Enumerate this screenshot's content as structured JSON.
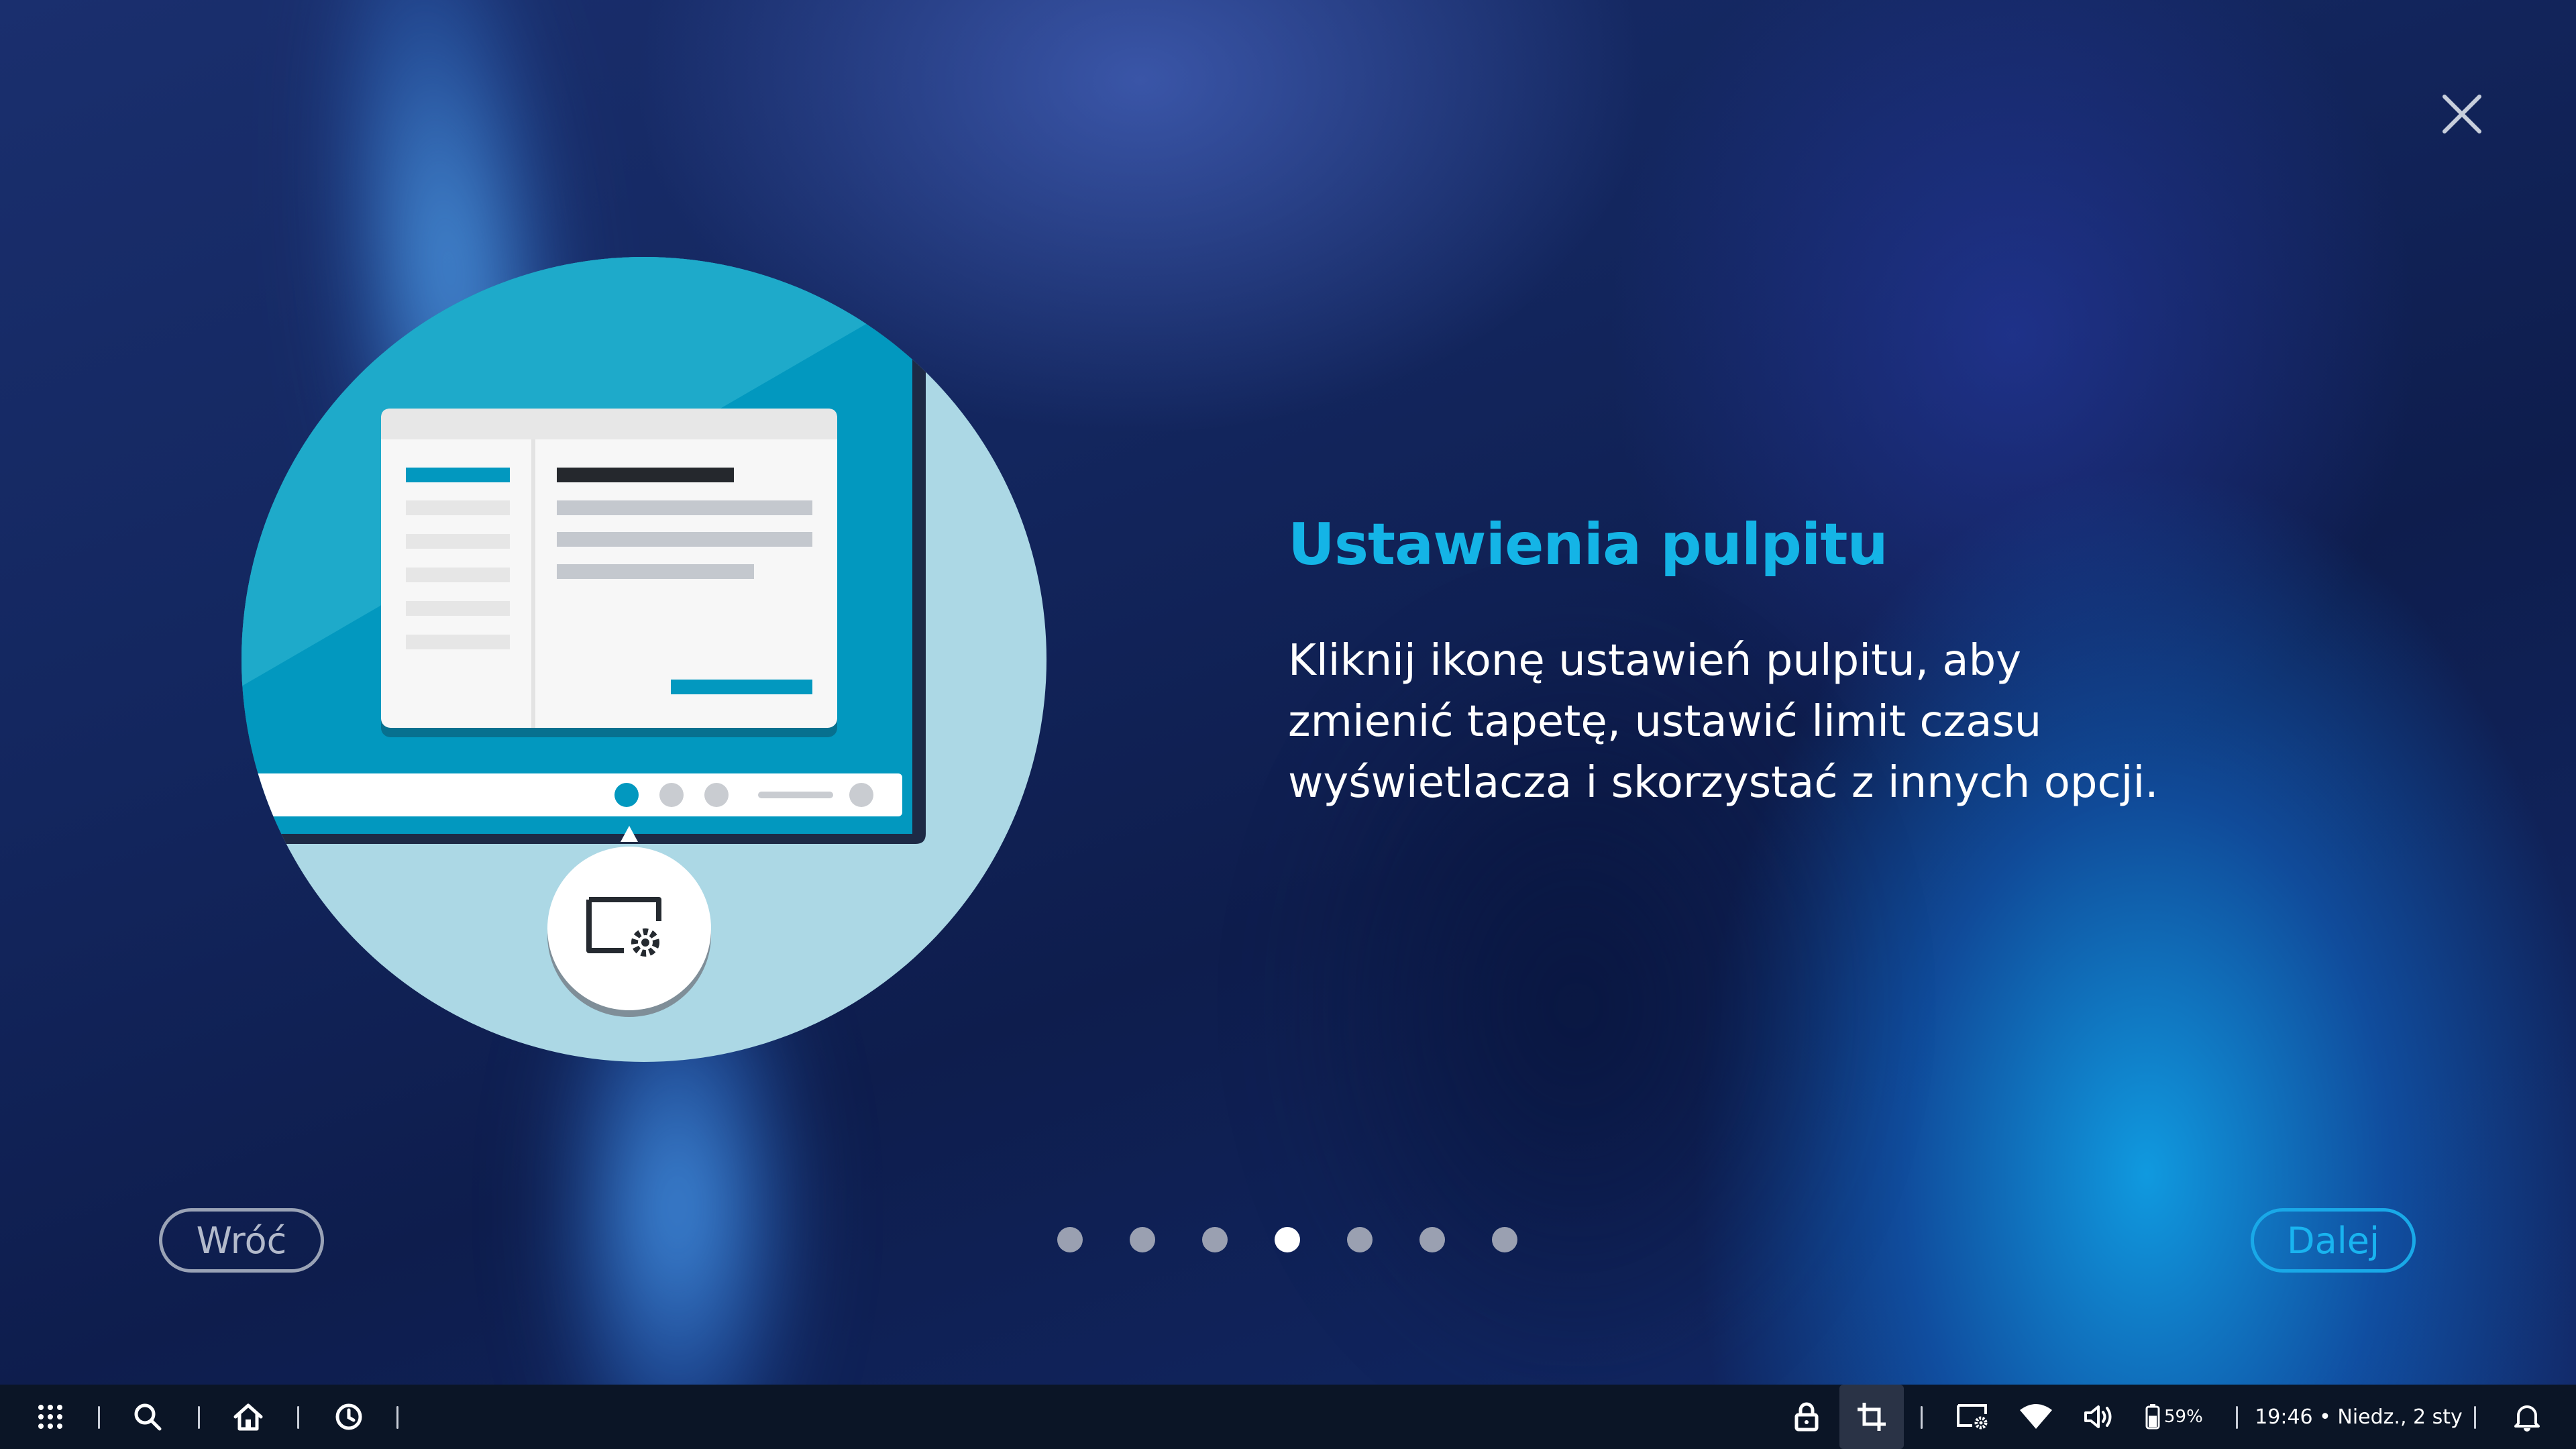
{
  "slide": {
    "title": "Ustawienia pulpitu",
    "description": "Kliknij ikonę ustawień pulpitu, aby zmienić tapetę, ustawić limit czasu wyświetlacza i skorzystać z innych opcji.",
    "current_page": 4,
    "total_pages": 7
  },
  "buttons": {
    "back_label": "Wróć",
    "next_label": "Dalej"
  },
  "icons": {
    "close": "close-icon",
    "illustration_badge": "desktop-settings-icon"
  },
  "colors": {
    "title": "#14b4e6",
    "next_accent": "#19a9e8",
    "dot_active": "#ffffff",
    "dot_inactive": "#9aa0b1"
  },
  "taskbar": {
    "left_icons": [
      "apps-grid-icon",
      "search-icon",
      "home-icon",
      "clock-history-icon"
    ],
    "right_icons": [
      "lock-icon",
      "screenshot-crop-icon",
      "desktop-settings-icon",
      "wifi-icon",
      "volume-icon",
      "battery-icon",
      "bell-icon"
    ],
    "battery_percent": "59%",
    "clock": "19:46 • Niedz., 2 sty"
  }
}
